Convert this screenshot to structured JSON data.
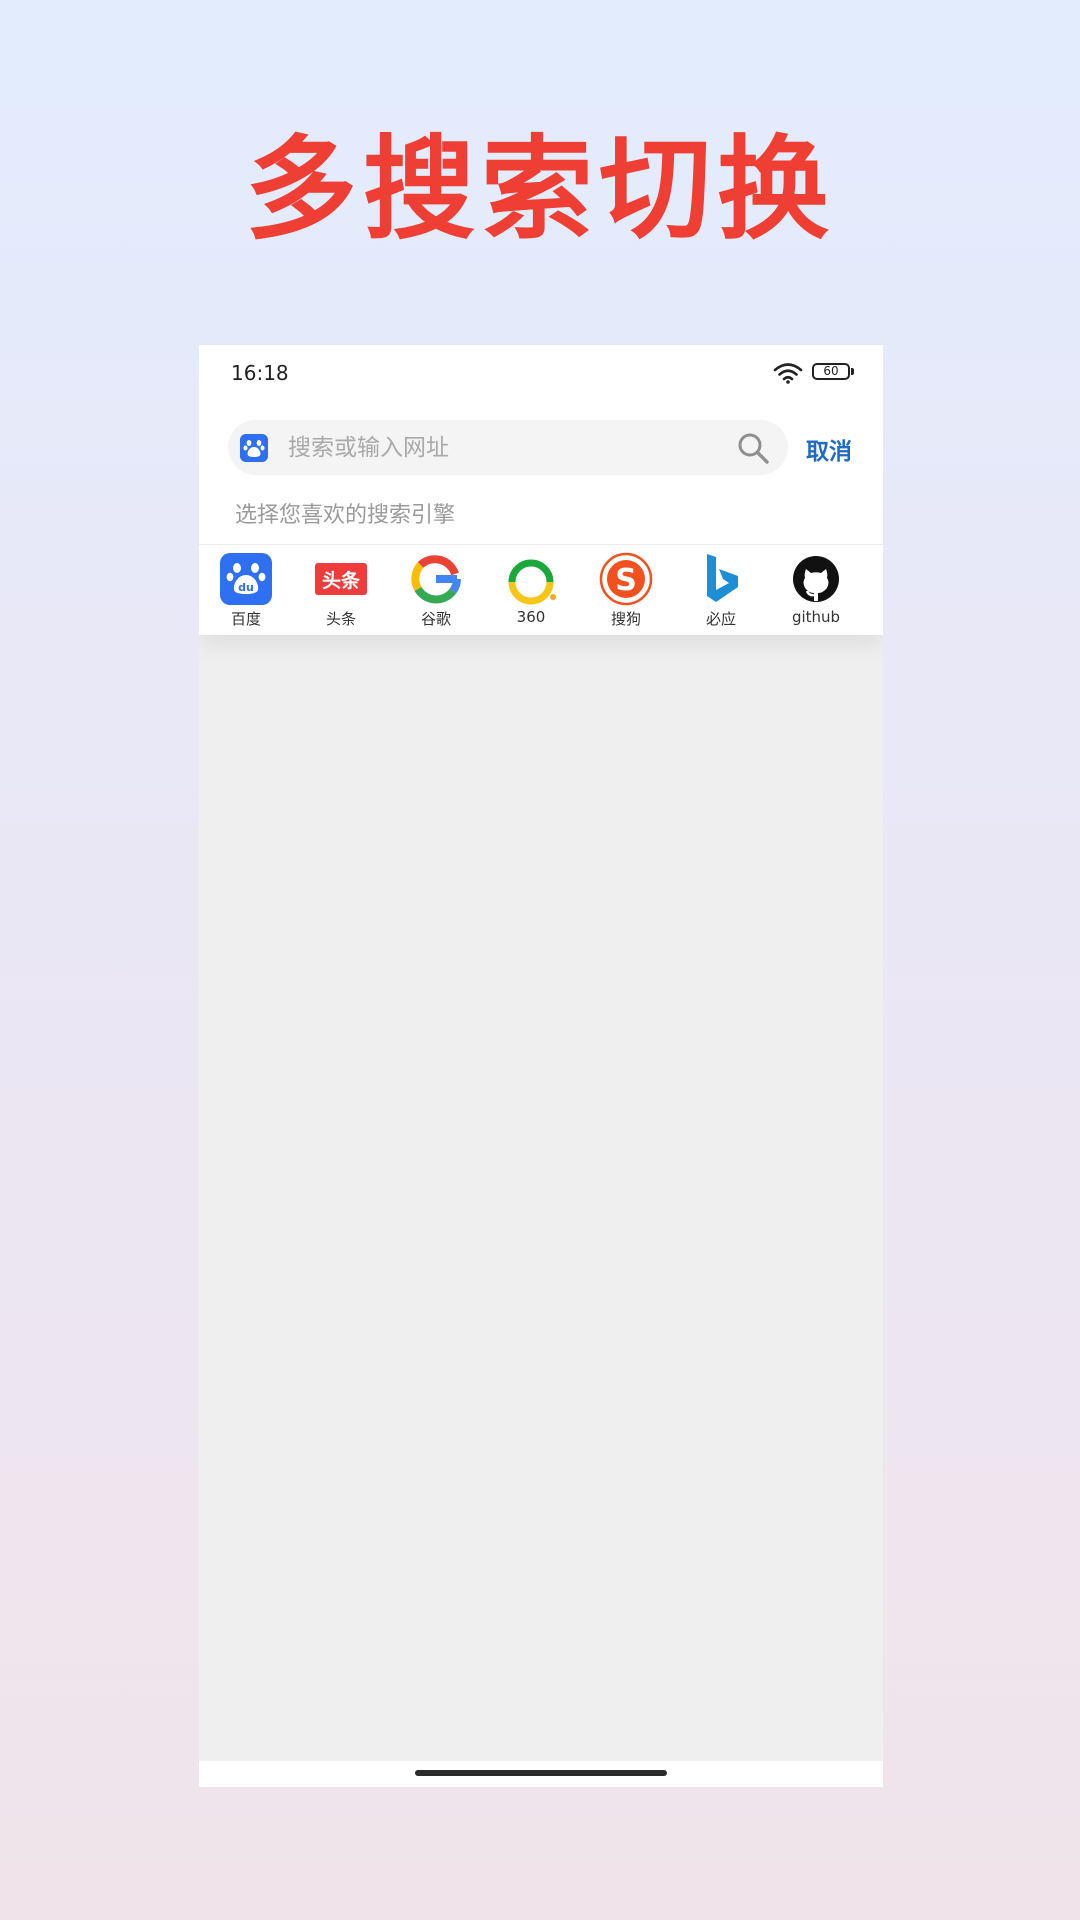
{
  "headline": "多搜索切换",
  "status_bar": {
    "time": "16:18",
    "battery": "60"
  },
  "search": {
    "placeholder": "搜索或输入网址",
    "value": "",
    "engine_icon": "baidu-paw-icon",
    "cancel_label": "取消"
  },
  "hint": "选择您喜欢的搜索引擎",
  "engines": [
    {
      "label": "百度",
      "icon": "baidu-icon",
      "color": "#2f6ff2"
    },
    {
      "label": "头条",
      "icon": "toutiao-icon",
      "color": "#ee3c3c"
    },
    {
      "label": "谷歌",
      "icon": "google-icon",
      "color": "#4285f4"
    },
    {
      "label": "360",
      "icon": "360-icon",
      "color": "#1aa83a"
    },
    {
      "label": "搜狗",
      "icon": "sogou-icon",
      "color": "#f0511f"
    },
    {
      "label": "必应",
      "icon": "bing-icon",
      "color": "#1e8ed6"
    },
    {
      "label": "github",
      "icon": "github-icon",
      "color": "#111111"
    }
  ],
  "colors": {
    "headline": "#ef3e33",
    "accent": "#1f6bc3",
    "content_bg": "#efefef"
  }
}
